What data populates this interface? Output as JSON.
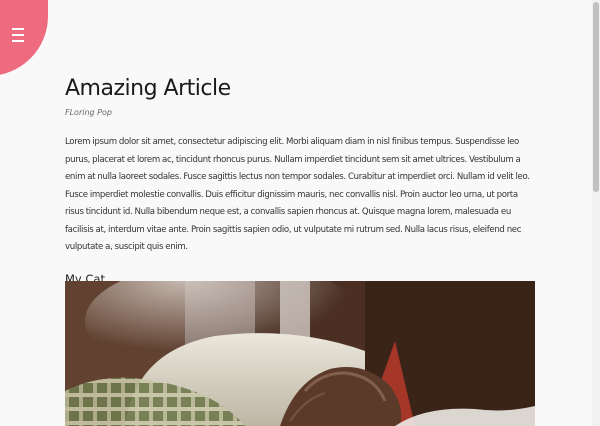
{
  "menu": {
    "icon": "hamburger-menu-icon",
    "color": "#ee6a7f"
  },
  "article": {
    "title": "Amazing Article",
    "author": "FLoring Pop",
    "body": "Lorem ipsum dolor sit amet, consectetur adipiscing elit. Morbi aliquam diam in nisl finibus tempus. Suspendisse leo purus, placerat et lorem ac, tincidunt rhoncus purus. Nullam imperdiet tincidunt sem sit amet ultrices. Vestibulum a enim at nulla laoreet sodales. Fusce sagittis lectus non tempor sodales. Curabitur at imperdiet orci. Nullam id velit leo. Fusce imperdiet molestie convallis. Duis efficitur dignissim mauris, nec convallis nisl. Proin auctor leo urna, ut porta risus tincidunt id. Nulla bibendum neque est, a convallis sapien rhoncus at. Quisque magna lorem, malesuada eu facilisis at, interdum vitae ante. Proin sagittis sapien odio, ut vulputate mi rutrum sed. Nulla lacus risus, eleifend nec vulputate a, suscipit quis enim.",
    "section_heading": "My Cat",
    "image": "cat-photo"
  }
}
